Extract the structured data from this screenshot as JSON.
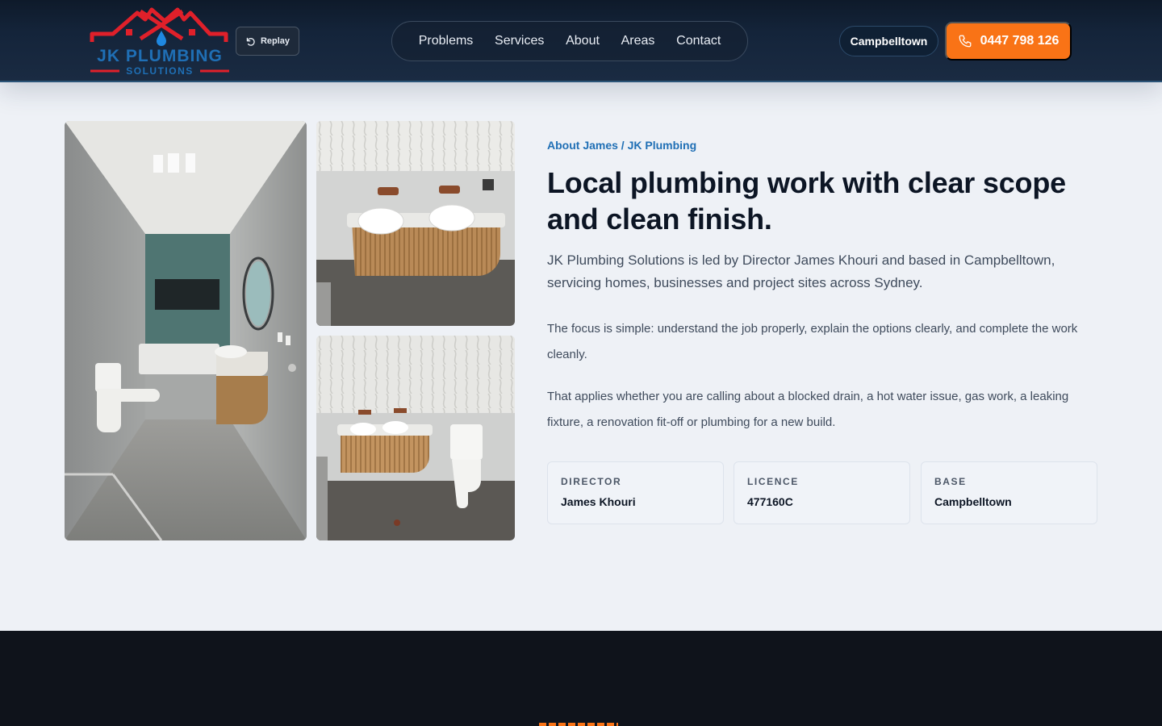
{
  "header": {
    "logo": {
      "line1": "JK PLUMBING",
      "line2": "SOLUTIONS"
    },
    "replay_label": "Replay",
    "nav": [
      {
        "label": "Problems"
      },
      {
        "label": "Services"
      },
      {
        "label": "About"
      },
      {
        "label": "Areas"
      },
      {
        "label": "Contact"
      }
    ],
    "location_label": "Campbelltown",
    "phone_label": "0447 798 126"
  },
  "about": {
    "eyebrow": "About James / JK Plumbing",
    "heading": "Local plumbing work with clear scope and clean finish.",
    "lead": "JK Plumbing Solutions is led by Director James Khouri and based in Campbelltown, servicing homes, businesses and project sites across Sydney.",
    "paragraphs": [
      "The focus is simple: understand the job properly, explain the options clearly, and complete the work cleanly.",
      "That applies whether you are calling about a blocked drain, a hot water issue, gas work, a leaking fixture, a renovation fit-off or plumbing for a new build."
    ],
    "facts": [
      {
        "label": "DIRECTOR",
        "value": "James Khouri"
      },
      {
        "label": "LICENCE",
        "value": "477160C"
      },
      {
        "label": "BASE",
        "value": "Campbelltown"
      }
    ]
  },
  "colors": {
    "accent": "#f97316",
    "brand_red": "#e0202a",
    "brand_blue": "#1f6fb5",
    "heading": "#0c1524",
    "header_bg": "#14243a"
  },
  "icons": {
    "replay": "refresh-icon",
    "phone": "phone-icon"
  }
}
